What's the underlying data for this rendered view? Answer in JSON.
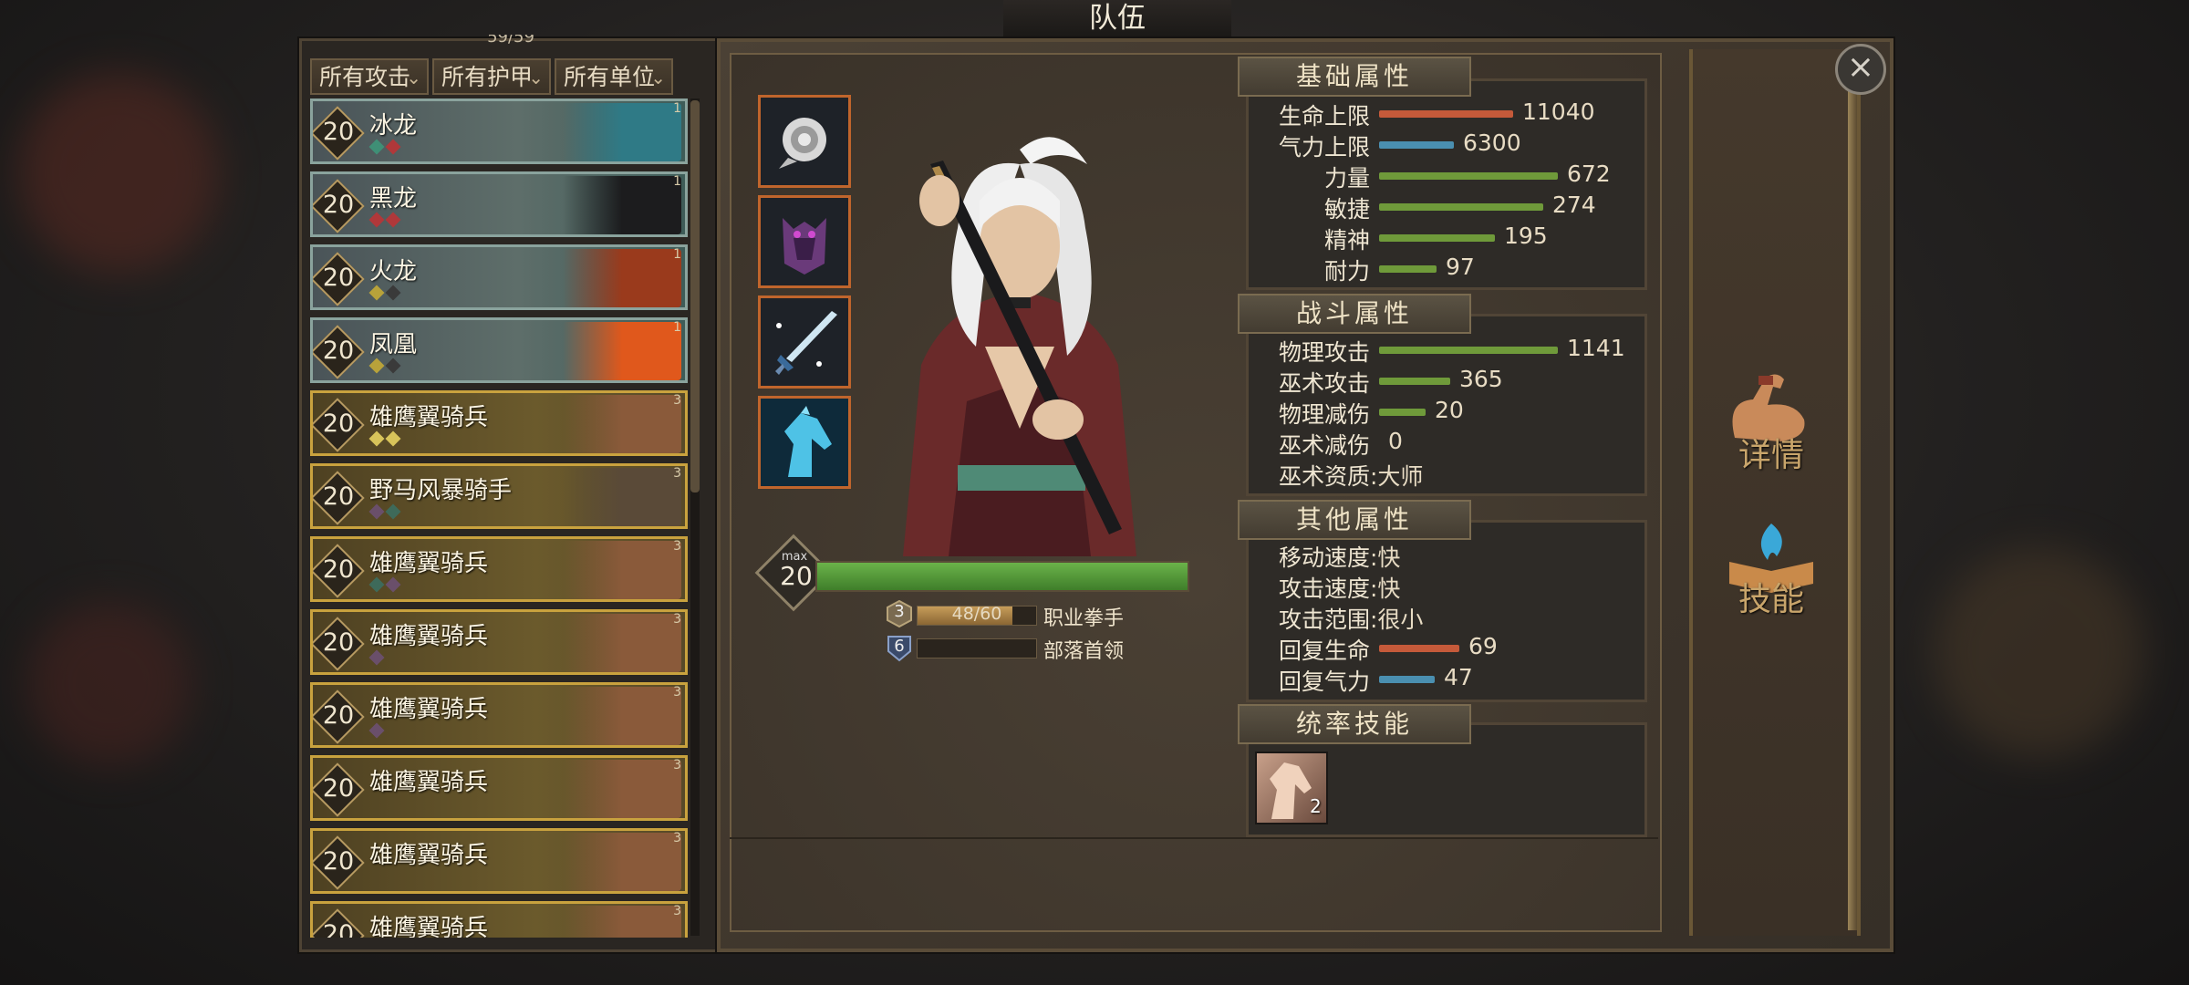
{
  "window": {
    "title": "队伍",
    "unit_count": "59/59"
  },
  "filters": [
    {
      "label": "所有攻击"
    },
    {
      "label": "所有护甲"
    },
    {
      "label": "所有单位"
    }
  ],
  "units": [
    {
      "level": "20",
      "name": "冰龙",
      "tier": "1",
      "kind": "dragon",
      "gems": [
        "#3f8f76",
        "#b0383a"
      ],
      "art_color": "#2f7a86"
    },
    {
      "level": "20",
      "name": "黑龙",
      "tier": "1",
      "kind": "dragon",
      "gems": [
        "#b0383a",
        "#b0383a"
      ],
      "art_color": "#1c1c1e"
    },
    {
      "level": "20",
      "name": "火龙",
      "tier": "1",
      "kind": "dragon",
      "gems": [
        "#b8a23a",
        "#3a3a3a"
      ],
      "art_color": "#9a3a1c"
    },
    {
      "level": "20",
      "name": "凤凰",
      "tier": "1",
      "kind": "dragon",
      "gems": [
        "#b8a23a",
        "#3a3a3a"
      ],
      "art_color": "#e0581c"
    },
    {
      "level": "20",
      "name": "雄鹰翼骑兵",
      "tier": "3",
      "kind": "cav",
      "gems": [
        "#d8c45a",
        "#d8c45a"
      ],
      "art_color": "#8a5a3a"
    },
    {
      "level": "20",
      "name": "野马风暴骑手",
      "tier": "3",
      "kind": "cav",
      "gems": [
        "#6a4f6a",
        "#3e6a5a"
      ],
      "art_color": "#5a4a38"
    },
    {
      "level": "20",
      "name": "雄鹰翼骑兵",
      "tier": "3",
      "kind": "cav",
      "gems": [
        "#3e6a5a",
        "#6a4f6a"
      ],
      "art_color": "#8a5a3a"
    },
    {
      "level": "20",
      "name": "雄鹰翼骑兵",
      "tier": "3",
      "kind": "cav",
      "gems": [
        "#6a4f6a"
      ],
      "art_color": "#8a5a3a"
    },
    {
      "level": "20",
      "name": "雄鹰翼骑兵",
      "tier": "3",
      "kind": "cav",
      "gems": [
        "#6a4f6a"
      ],
      "art_color": "#8a5a3a"
    },
    {
      "level": "20",
      "name": "雄鹰翼骑兵",
      "tier": "3",
      "kind": "cav",
      "gems": [],
      "art_color": "#8a5a3a"
    },
    {
      "level": "20",
      "name": "雄鹰翼骑兵",
      "tier": "3",
      "kind": "cav",
      "gems": [],
      "art_color": "#8a5a3a"
    },
    {
      "level": "20",
      "name": "雄鹰翼骑兵",
      "tier": "3",
      "kind": "cav",
      "gems": [],
      "art_color": "#8a5a3a"
    }
  ],
  "hero": {
    "max_label": "max",
    "level": "20",
    "xp_fraction": 1.0,
    "profession": {
      "rank": "3",
      "progress": "48/60",
      "progress_fraction": 0.8,
      "title": "职业拳手"
    },
    "tribe": {
      "rank": "6",
      "progress_fraction": 0.0,
      "title": "部落首领"
    }
  },
  "sections": {
    "basic": {
      "header": "基础属性"
    },
    "combat": {
      "header": "战斗属性"
    },
    "other": {
      "header": "其他属性"
    },
    "command": {
      "header": "统率技能",
      "skill_count": "2"
    }
  },
  "basic_stats": [
    {
      "label": "生命上限",
      "value": "11040",
      "fraction": 0.75,
      "color": "#c55a3a"
    },
    {
      "label": "气力上限",
      "value": "6300",
      "fraction": 0.42,
      "color": "#4a8fb0"
    },
    {
      "label": "力量",
      "value": "672",
      "fraction": 1.0,
      "color": "#6f9a3a"
    },
    {
      "label": "敏捷",
      "value": "274",
      "fraction": 0.92,
      "color": "#6f9a3a"
    },
    {
      "label": "精神",
      "value": "195",
      "fraction": 0.65,
      "color": "#6f9a3a"
    },
    {
      "label": "耐力",
      "value": "97",
      "fraction": 0.32,
      "color": "#6f9a3a"
    }
  ],
  "combat_stats": [
    {
      "label": "物理攻击",
      "value": "1141",
      "fraction": 1.0,
      "color": "#6f9a3a"
    },
    {
      "label": "巫术攻击",
      "value": "365",
      "fraction": 0.4,
      "color": "#6f9a3a"
    },
    {
      "label": "物理减伤",
      "value": "20",
      "fraction": 0.26,
      "color": "#6f9a3a"
    },
    {
      "label": "巫术减伤",
      "value": "0",
      "fraction": 0.0,
      "color": "#6f9a3a"
    },
    {
      "label": "巫术资质",
      "value": ":大师",
      "fraction": null,
      "color": ""
    }
  ],
  "other_stats": [
    {
      "label": "移动速度",
      "value": ":快",
      "fraction": null,
      "color": ""
    },
    {
      "label": "攻击速度",
      "value": ":快",
      "fraction": null,
      "color": ""
    },
    {
      "label": "攻击范围",
      "value": ":很小",
      "fraction": null,
      "color": ""
    },
    {
      "label": "回复生命",
      "value": "69",
      "fraction": 0.45,
      "color": "#c55a3a"
    },
    {
      "label": "回复气力",
      "value": "47",
      "fraction": 0.31,
      "color": "#4a8fb0"
    }
  ],
  "side": {
    "details_label": "详情",
    "skills_label": "技能"
  },
  "icons": {
    "close": "close-icon",
    "details": "flexed-arm-icon",
    "skills": "spellbook-flame-icon",
    "equip": [
      "rose-icon",
      "demon-armor-icon",
      "ice-sword-icon",
      "spirit-horse-icon"
    ],
    "skill": "horse-head-icon"
  }
}
